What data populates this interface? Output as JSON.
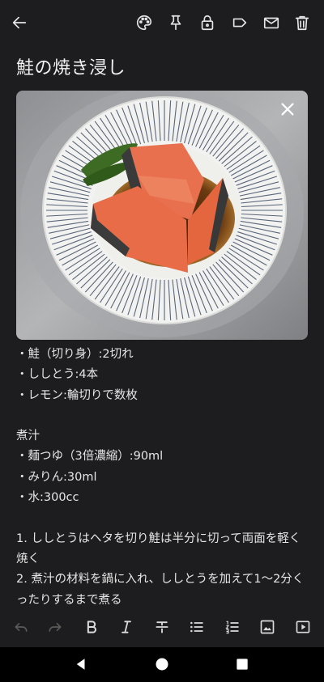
{
  "toolbar": {
    "icons": [
      "back-arrow-icon",
      "palette-icon",
      "pin-icon",
      "lock-icon",
      "label-icon",
      "mail-icon",
      "trash-icon"
    ]
  },
  "note": {
    "title": "鮭の焼き浸し",
    "lines": [
      "・鮭（切り身）:2切れ",
      "・ししとう:4本",
      "・レモン:輪切りで数枚",
      "",
      "煮汁",
      "・麺つゆ（3倍濃縮）:90ml",
      "・みりん:30ml",
      "・水:300cc",
      "",
      "1. ししとうはヘタを切り鮭は半分に切って両面を軽く焼く",
      "2. 煮汁の材料を鍋に入れ、ししとうを加えて1～2分くったりするまで煮る"
    ]
  },
  "format_bar": {
    "icons": [
      "undo-icon",
      "redo-icon",
      "bold-icon",
      "italic-icon",
      "strikethrough-icon",
      "bulleted-list-icon",
      "numbered-list-icon",
      "insert-image-icon",
      "insert-video-icon"
    ]
  },
  "nav": {
    "icons": [
      "nav-back-icon",
      "nav-home-icon",
      "nav-recents-icon"
    ]
  },
  "colors": {
    "background": "#1d1d1f",
    "text": "#e8e8e8",
    "disabled_icon": "#5a5a5a"
  }
}
